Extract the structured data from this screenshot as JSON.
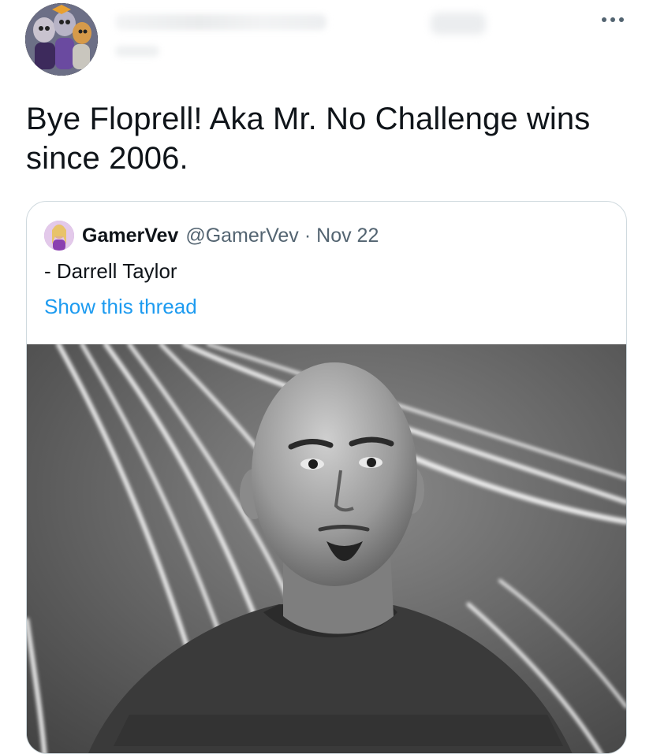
{
  "tweet": {
    "text": "Bye Floprell! Aka Mr. No Challenge wins since 2006.",
    "more_icon": "ellipsis-icon"
  },
  "quote": {
    "author_name": "GamerVev",
    "author_handle": "@GamerVev",
    "separator": "·",
    "date": "Nov 22",
    "text": "- Darrell Taylor",
    "show_thread": "Show this thread"
  },
  "colors": {
    "text": "#0f1419",
    "secondary": "#536471",
    "link": "#1d9bf0",
    "border": "#cfd9de"
  }
}
